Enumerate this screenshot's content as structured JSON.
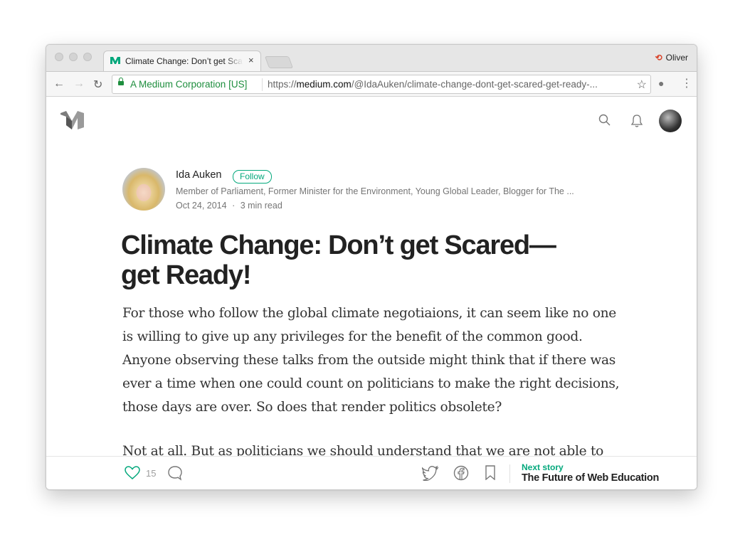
{
  "browser": {
    "tab": {
      "title": "Climate Change: Don’t get Scared—get Ready!",
      "close_icon": "×"
    },
    "profile_name": "Oliver",
    "address": {
      "security_label": "A Medium Corporation [US]",
      "url_scheme": "https://",
      "url_host": "medium.com",
      "url_path": "/@IdaAuken/climate-change-dont-get-scared-get-ready-..."
    },
    "icons": {
      "back": "←",
      "forward": "→",
      "reload": "↻",
      "bookmark_star": "☆",
      "menu": "⋮",
      "extension": "●"
    }
  },
  "article": {
    "author": {
      "name": "Ida Auken",
      "follow_label": "Follow",
      "bio": "Member of Parliament, Former Minister for the Environment, Young Global Leader, Blogger for The ...",
      "date": "Oct 24, 2014",
      "read_time": "3 min read",
      "meta_separator": "·"
    },
    "title_line1": "Climate Change: Don’t get Scared—",
    "title_line2": "get Ready!",
    "paragraphs": [
      "For those who follow the global climate negotiaions, it can seem like no one is willing to give up any privileges for the benefit of the common good. Anyone observing these talks from the outside might think that if there was ever a time when one could count on politicians to make the right decisions, those days are over. So does that render politics obsolete?",
      "Not at all. But as politicians we should understand that we are not able to"
    ]
  },
  "footer": {
    "claps": "15",
    "next_story_label": "Next story",
    "next_story_title": "The Future of Web Education"
  },
  "colors": {
    "accent_green": "#03a87c",
    "secure_green": "#1e8e3e",
    "text_dark": "#222222",
    "text_muted": "#757575"
  }
}
